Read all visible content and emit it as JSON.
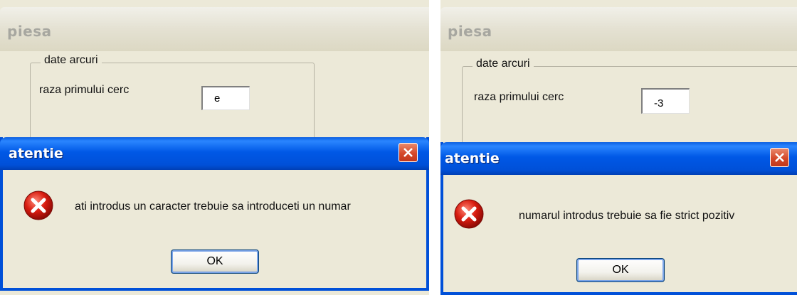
{
  "left": {
    "window_title": "piesa",
    "group_label": "date arcuri",
    "field_label": "raza primului cerc",
    "field_value": "e",
    "dialog": {
      "title": "atentie",
      "message": "ati introdus un caracter trebuie sa introduceti un numar",
      "ok_label": "OK"
    }
  },
  "right": {
    "window_title": "piesa",
    "group_label": "date arcuri",
    "field_label": "raza primului cerc",
    "field_value": "-3",
    "dialog": {
      "title": "atentie",
      "message": "numarul introdus trebuie sa fie strict pozitiv",
      "ok_label": "OK"
    }
  },
  "icons": {
    "close": "close-icon",
    "error": "error-icon"
  },
  "colors": {
    "title_bar": "#0054e3",
    "close_button": "#d5492a",
    "error_red": "#c41616",
    "dialog_bg": "#ece9d8"
  }
}
